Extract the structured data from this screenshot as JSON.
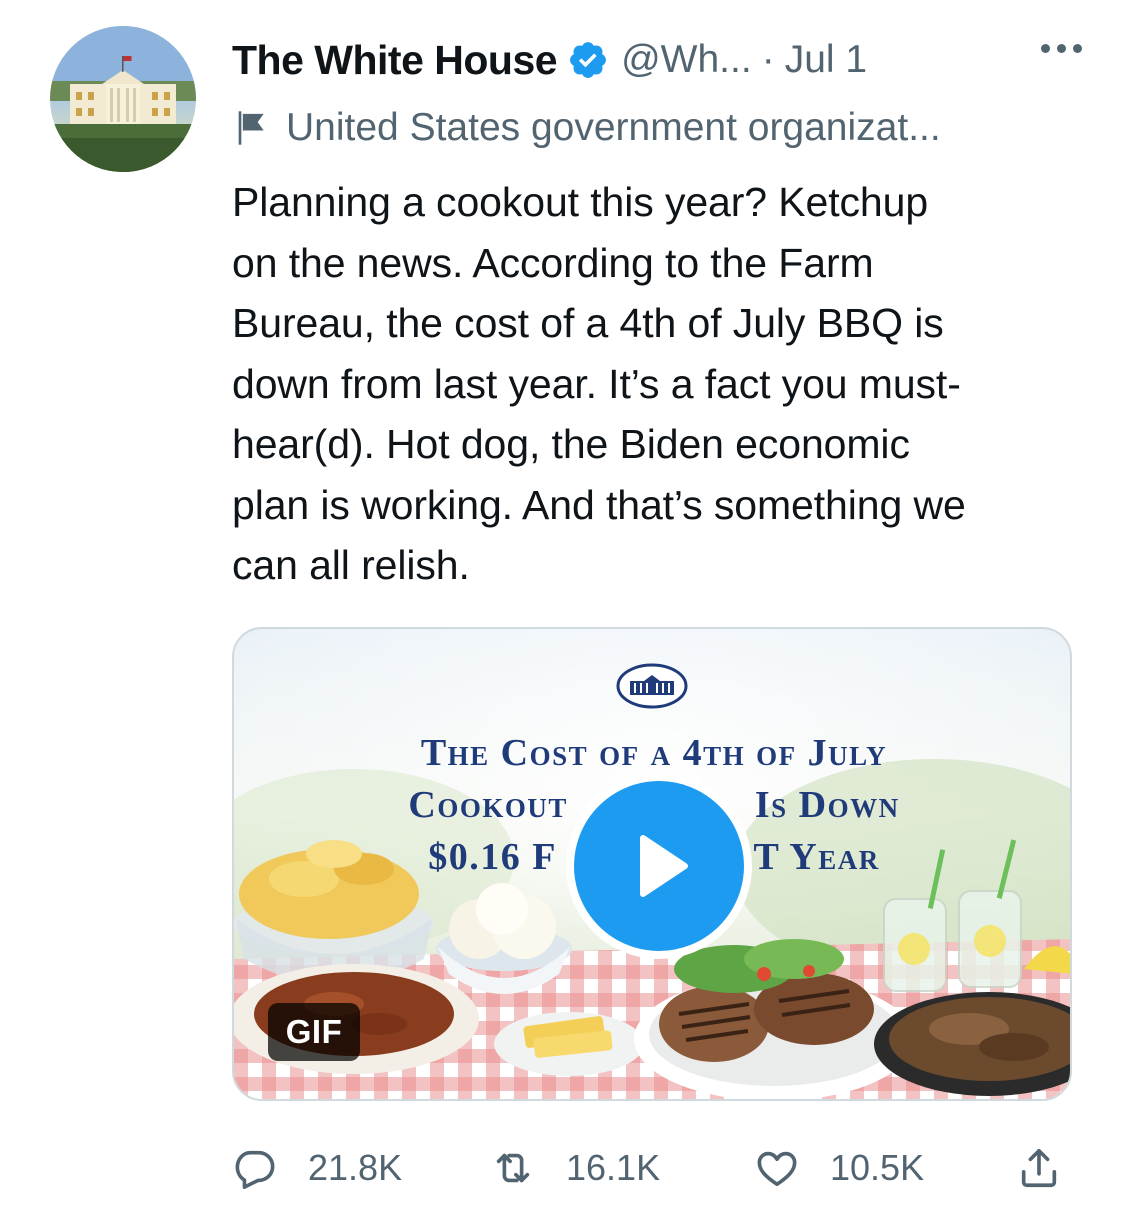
{
  "tweet": {
    "author_name": "The White House",
    "handle": "@Wh...",
    "separator": "·",
    "date": "Jul 1",
    "org_label": "United States government organizat...",
    "text": "Planning a cookout this year? Ketchup\non the news. According to the Farm\nBureau, the cost of a 4th of July BBQ is\ndown from last year. It’s a fact you must-\nhear(d). Hot dog, the Biden economic\nplan is working. And that’s something we\ncan all relish."
  },
  "media": {
    "headline_line1": "The Cost of a 4th of July",
    "headline_line2": "Cookout                 Is Down",
    "headline_line3": "$0.16 F                  T Year",
    "badge": "GIF"
  },
  "actions": {
    "replies": "21.8K",
    "retweets": "16.1K",
    "likes": "10.5K"
  },
  "colors": {
    "accent": "#1d9bf0",
    "secondary_text": "#536471",
    "headline": "#1f3b7a"
  }
}
